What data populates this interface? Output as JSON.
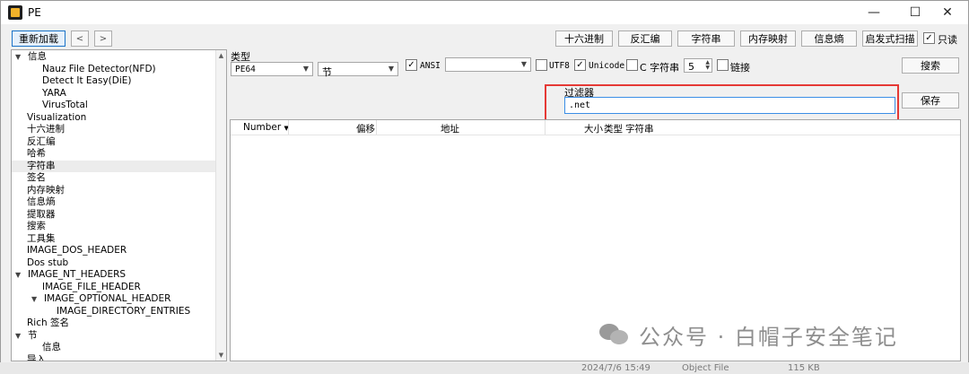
{
  "window": {
    "title": "PE",
    "controls": {
      "minimize": "—",
      "maximize": "☐",
      "close": "✕"
    }
  },
  "toolbar": {
    "reload": "重新加载",
    "back": "<",
    "forward": ">",
    "buttons": [
      "十六进制",
      "反汇编",
      "字符串",
      "内存映射",
      "信息熵",
      "启发式扫描"
    ],
    "readonly_label": "只读",
    "readonly_checked": "✓"
  },
  "tree": {
    "items": [
      {
        "label": "信息",
        "arrow": "▼"
      },
      {
        "label": "Nauz File Detector(NFD)"
      },
      {
        "label": "Detect It Easy(DiE)"
      },
      {
        "label": "YARA"
      },
      {
        "label": "VirusTotal"
      },
      {
        "label": "Visualization"
      },
      {
        "label": "十六进制"
      },
      {
        "label": "反汇编"
      },
      {
        "label": "哈希"
      },
      {
        "label": "字符串"
      },
      {
        "label": "签名"
      },
      {
        "label": "内存映射"
      },
      {
        "label": "信息熵"
      },
      {
        "label": "提取器"
      },
      {
        "label": "搜索"
      },
      {
        "label": "工具集"
      },
      {
        "label": "IMAGE_DOS_HEADER"
      },
      {
        "label": "Dos stub"
      },
      {
        "label": "IMAGE_NT_HEADERS",
        "arrow": "▼"
      },
      {
        "label": "IMAGE_FILE_HEADER"
      },
      {
        "label": "IMAGE_OPTIONAL_HEADER",
        "arrow": "▼"
      },
      {
        "label": "IMAGE_DIRECTORY_ENTRIES"
      },
      {
        "label": "Rich 签名"
      },
      {
        "label": "节",
        "arrow": "▼"
      },
      {
        "label": "信息"
      },
      {
        "label": "导入"
      }
    ],
    "scroll_up": "▲",
    "scroll_down": "▼"
  },
  "strings_panel": {
    "type_label": "类型",
    "type_value": "PE64",
    "section_value": "节",
    "ansi_label": "ANSI",
    "ansi_checked": "✓",
    "encoding_value": "",
    "utf8_label": "UTF8",
    "unicode_label": "Unicode",
    "unicode_checked": "✓",
    "cstring_label": "C 字符串",
    "min_length": "5",
    "link_label": "链接",
    "search_button": "搜索",
    "save_button": "保存",
    "filter_label": "过滤器",
    "filter_value": ".net",
    "columns": [
      "Number",
      "偏移",
      "地址",
      "大小",
      "类型",
      "字符串"
    ],
    "sort_indicator": "▼"
  },
  "background_strip": {
    "date": "2024/7/6 15:49",
    "kind": "Object File",
    "size": "115 KB"
  },
  "watermark": {
    "text": "公众号 · 白帽子安全笔记"
  }
}
